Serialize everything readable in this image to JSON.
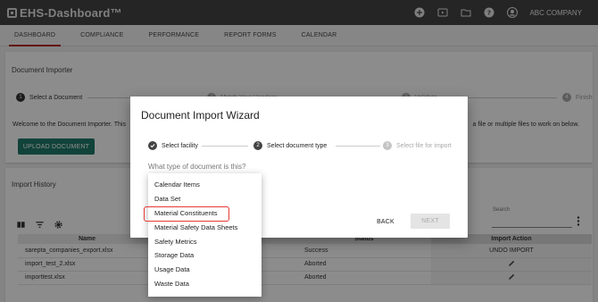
{
  "app": {
    "title": "EHS-Dashboard™",
    "company": "ABC COMPANY",
    "top_icons": [
      "add-circle-icon",
      "video-icon",
      "folder-icon",
      "help-icon",
      "account-icon"
    ]
  },
  "nav": {
    "tabs": [
      "DASHBOARD",
      "COMPLIANCE",
      "PERFORMANCE",
      "REPORT FORMS",
      "CALENDAR"
    ],
    "active": "DASHBOARD",
    "accent": "#b71c1c"
  },
  "importer": {
    "title": "Document Importer",
    "steps": [
      {
        "num": "1",
        "label": "Select a Document"
      },
      {
        "num": "2",
        "label": "Match Your Headers"
      },
      {
        "num": "3",
        "label": "Validate"
      },
      {
        "num": "4",
        "label": "Finish"
      }
    ],
    "welcome_left": "Welcome to the Document Importer. This",
    "welcome_right": "a file or multiple files to work on below.",
    "upload_label": "UPLOAD DOCUMENT",
    "upload_color": "#1f7a6b"
  },
  "history": {
    "title": "Import History",
    "search_label": "Search",
    "columns": [
      "Name",
      "Status",
      "Import Action"
    ],
    "rows": [
      {
        "name": "sarepta_companies_export.xlsx",
        "status": "Success",
        "action": "UNDO IMPORT"
      },
      {
        "name": "import_test_2.xlsx",
        "status": "Aborted",
        "action": ""
      },
      {
        "name": "importtest.xlsx",
        "status": "Aborted",
        "action": ""
      }
    ]
  },
  "dialog": {
    "title": "Document Import Wizard",
    "steps": [
      {
        "label": "Select facility",
        "state": "done"
      },
      {
        "num": "2",
        "label": "Select document type",
        "state": "active"
      },
      {
        "num": "3",
        "label": "Select file for import",
        "state": "pending"
      }
    ],
    "question": "What type of document is this?",
    "back_label": "BACK",
    "next_label": "NEXT"
  },
  "dropdown": {
    "options": [
      "Calendar Items",
      "Data Set",
      "Material Constituents",
      "Material Safety Data Sheets",
      "Safety Metrics",
      "Storage Data",
      "Usage Data",
      "Waste Data"
    ],
    "highlighted": "Material Constituents",
    "highlight_color": "#e53935"
  }
}
